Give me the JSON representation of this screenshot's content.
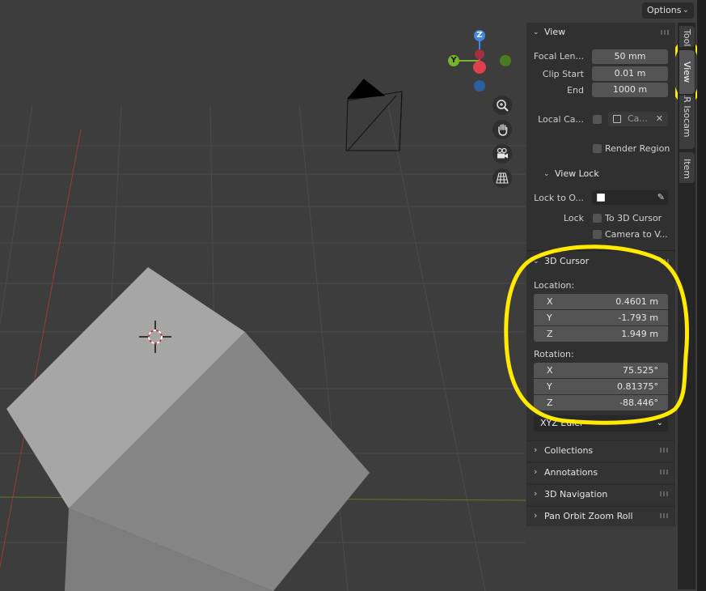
{
  "header": {
    "options_label": "Options"
  },
  "navigation_gizmo": {
    "z_label": "Z",
    "y_label": "Y"
  },
  "sidebar_tabs": [
    {
      "label": "Tool"
    },
    {
      "label": "View"
    },
    {
      "label": "RRR Isocam"
    },
    {
      "label": "Item"
    }
  ],
  "view_panel": {
    "title": "View",
    "focal_length_label": "Focal Len...",
    "focal_length_value": "50 mm",
    "clip_start_label": "Clip Start",
    "clip_start_value": "0.01 m",
    "clip_end_label": "End",
    "clip_end_value": "1000 m",
    "local_camera_label": "Local Ca...",
    "local_camera_value": "Ca...",
    "render_region_label": "Render Region",
    "view_lock": {
      "title": "View Lock",
      "lock_to_object_label": "Lock to O...",
      "lock_label": "Lock",
      "to_3d_cursor_label": "To 3D Cursor",
      "camera_to_view_label": "Camera to V..."
    }
  },
  "cursor_panel": {
    "title": "3D Cursor",
    "location_label": "Location:",
    "location": [
      {
        "axis": "X",
        "value": "0.4601 m"
      },
      {
        "axis": "Y",
        "value": "-1.793 m"
      },
      {
        "axis": "Z",
        "value": "1.949 m"
      }
    ],
    "rotation_label": "Rotation:",
    "rotation": [
      {
        "axis": "X",
        "value": "75.525°"
      },
      {
        "axis": "Y",
        "value": "0.81375°"
      },
      {
        "axis": "Z",
        "value": "-88.446°"
      }
    ],
    "rotation_mode": "XYZ Euler"
  },
  "collapsed_panels": [
    {
      "title": "Collections"
    },
    {
      "title": "Annotations"
    },
    {
      "title": "3D Navigation"
    },
    {
      "title": "Pan Orbit Zoom Roll"
    }
  ],
  "colors": {
    "annotation_yellow": "#ffea00",
    "x_axis_red": "#e0404e",
    "y_axis_green": "#75b52b",
    "z_axis_blue": "#3f87e0"
  }
}
